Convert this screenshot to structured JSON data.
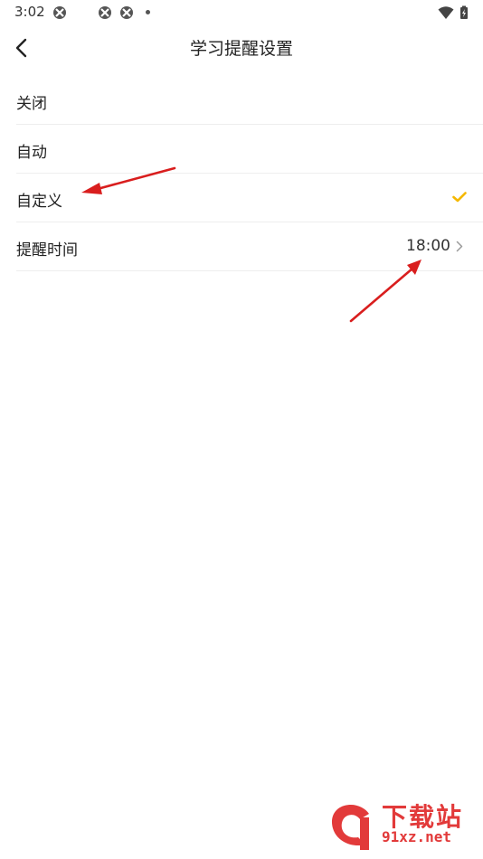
{
  "status_bar": {
    "time": "3:02",
    "icons": [
      "app-notification-icon",
      "app-notification-icon",
      "app-notification-icon",
      "more-dot-icon",
      "wifi-icon",
      "battery-icon"
    ]
  },
  "header": {
    "title": "学习提醒设置",
    "back_icon": "chevron-left-icon"
  },
  "settings": {
    "rows": [
      {
        "label": "关闭"
      },
      {
        "label": "自动"
      },
      {
        "label": "自定义",
        "selected": true,
        "icon": "check-icon"
      },
      {
        "label": "提醒时间",
        "value": "18:00",
        "icon": "chevron-right-icon"
      }
    ]
  },
  "colors": {
    "check": "#F5B800",
    "annotation": "#D91E1E",
    "watermark": "#E23A3A"
  },
  "watermark": {
    "cn": "下载站",
    "en": "91xz.net"
  }
}
